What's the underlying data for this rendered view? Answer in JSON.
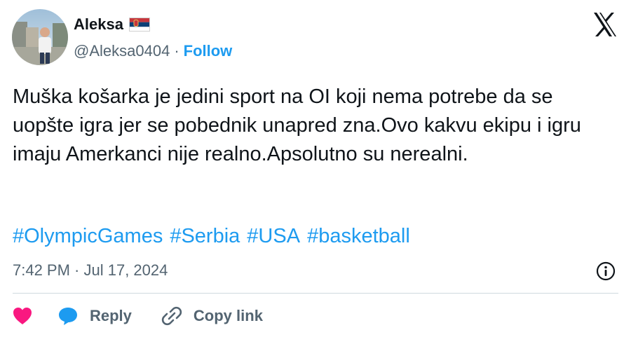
{
  "author": {
    "name": "Aleksa",
    "flag_icon": "serbia-flag-icon",
    "handle": "@Aleksa0404",
    "separator": "·",
    "follow_label": "Follow"
  },
  "platform_icon": "x-logo-icon",
  "tweet": {
    "text": "Muška košarka je jedini sport na OI koji nema potrebe da se uopšte igra jer se pobednik unapred zna.Ovo kakvu ekipu i igru imaju Amerkanci nije realno.Apsolutno su nerealni.",
    "hashtags": [
      "#OlympicGames",
      "#Serbia",
      "#USA",
      "#basketball"
    ],
    "timestamp": "7:42 PM · Jul 17, 2024"
  },
  "actions": {
    "like_icon": "heart-icon",
    "reply_label": "Reply",
    "reply_icon": "speech-bubble-icon",
    "copy_label": "Copy link",
    "copy_icon": "link-icon",
    "info_icon": "info-icon"
  },
  "colors": {
    "accent": "#1d9bf0",
    "text": "#0f1419",
    "secondary": "#536471",
    "like": "#f91880"
  }
}
